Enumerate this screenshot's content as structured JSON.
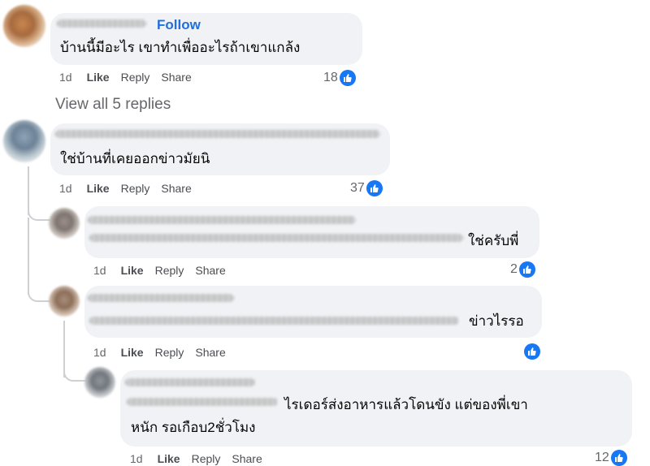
{
  "comments": [
    {
      "follow_label": "Follow",
      "text": "บ้านนี้มีอะไร เขาทำเพื่ออะไรถ้าเขาแกล้ง",
      "time": "1d",
      "like": "Like",
      "reply": "Reply",
      "share": "Share",
      "reactions": "18"
    },
    {
      "text": "ใช่บ้านที่เคยออกข่าวมัยนิ",
      "time": "1d",
      "like": "Like",
      "reply": "Reply",
      "share": "Share",
      "reactions": "37"
    },
    {
      "text": "ใช่ครับพี่",
      "time": "1d",
      "like": "Like",
      "reply": "Reply",
      "share": "Share",
      "reactions": "2"
    },
    {
      "text": "ข่าวไรรอ",
      "time": "1d",
      "like": "Like",
      "reply": "Reply",
      "share": "Share",
      "reactions": ""
    },
    {
      "text_line1": "ไรเดอร์ส่งอาหารแล้วโดนขัง แต่ของพี่เขา",
      "text_line2": "หนัก รอเกือบ2ชั่วโมง",
      "time": "1d",
      "like": "Like",
      "reply": "Reply",
      "share": "Share",
      "reactions": "12"
    }
  ],
  "view_replies_label": "View all 5 replies",
  "colors": {
    "bubble": "#f0f2f5",
    "follow": "#216fdb",
    "like_badge": "#1877f2",
    "meta_text": "#65676b"
  },
  "icons": {
    "reaction": "like-thumb-icon"
  }
}
